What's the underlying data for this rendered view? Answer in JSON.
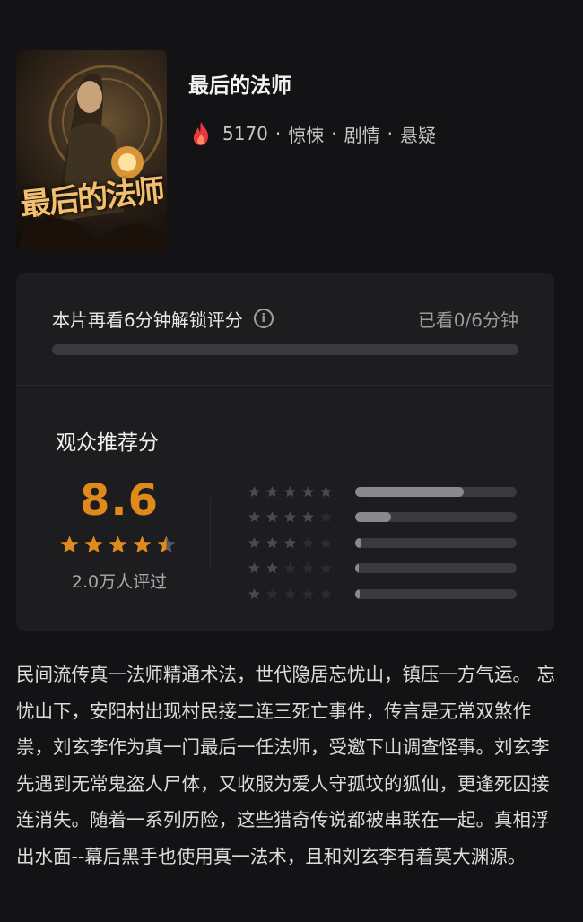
{
  "movie": {
    "title": "最后的法师",
    "poster_text": "最后的法师",
    "heat": "5170",
    "genres": [
      "惊悚",
      "剧情",
      "悬疑"
    ],
    "separator": "·"
  },
  "unlock": {
    "label": "本片再看6分钟解锁评分",
    "watched": "已看0/6分钟",
    "progress": 0
  },
  "rating": {
    "heading": "观众推荐分",
    "score": "8.6",
    "stars": 4.5,
    "count_label": "2.0万人评过",
    "distribution": [
      {
        "stars": 5,
        "fraction": 0.67
      },
      {
        "stars": 4,
        "fraction": 0.22
      },
      {
        "stars": 3,
        "fraction": 0.04
      },
      {
        "stars": 2,
        "fraction": 0.02
      },
      {
        "stars": 1,
        "fraction": 0.03
      }
    ]
  },
  "synopsis": " 民间流传真一法师精通术法，世代隐居忘忧山，镇压一方气运。 忘忧山下，安阳村出现村民接二连三死亡事件，传言是无常双煞作祟，刘玄李作为真一门最后一任法师，受邀下山调查怪事。刘玄李先遇到无常鬼盗人尸体，又收服为爱人守孤坟的狐仙，更逢死囚接连消失。随着一系列历险，这些猎奇传说都被串联在一起。真相浮出水面--幕后黑手也使用真一法术，且和刘玄李有着莫大渊源。",
  "colors": {
    "accent": "#e08a1e",
    "fire": "#e8393a",
    "background": "#131315",
    "card": "#1d1d20"
  },
  "icons": {
    "fire": "fire-icon",
    "info": "info-icon",
    "star": "star-icon"
  }
}
